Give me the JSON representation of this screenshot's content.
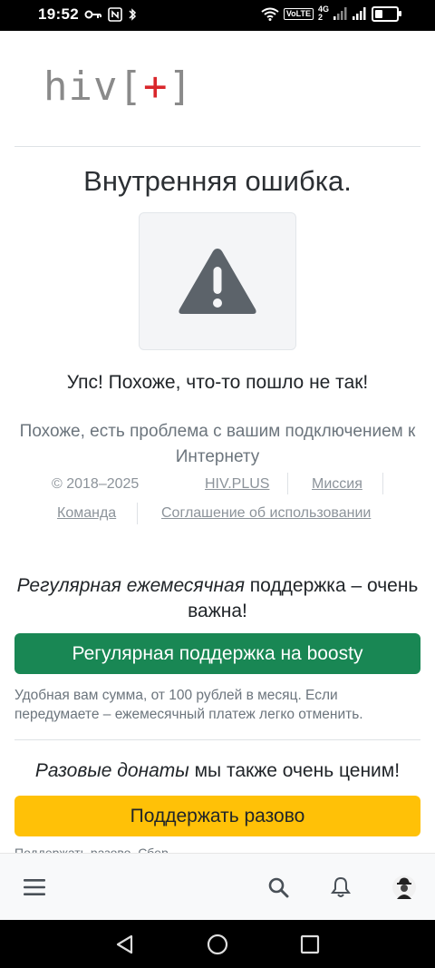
{
  "status_bar": {
    "time": "19:52",
    "volte": "VoLTE",
    "network": "4G",
    "sim_slot": "2",
    "battery_level": 0.35
  },
  "logo": {
    "left": "hiv[",
    "plus": "+",
    "right": "]"
  },
  "error": {
    "title": "Внутренняя ошибка.",
    "icon": "warning-triangle-icon",
    "oops": "Упс! Похоже, что-то пошло не так!",
    "connection_message": "Похоже, есть проблема с вашим подключением к Интернету"
  },
  "footer": {
    "copyright": "© 2018–2025",
    "links": [
      "HIV.PLUS",
      "Миссия",
      "Команда",
      "Соглашение об использовании"
    ]
  },
  "support": {
    "heading_italic": "Регулярная ежемесячная",
    "heading_rest": "поддержка – очень важна!",
    "boosty_button": "Регулярная поддержка на boosty",
    "note": "Удобная вам сумма, от 100 рублей в месяц. Если передумаете – ежемесячный платеж легко отменить.",
    "once_heading_italic": "Разовые донаты",
    "once_heading_rest": "мы также очень ценим!",
    "once_button": "Поддержать разово",
    "cut_text": "Поддержать разово, Сбер"
  },
  "colors": {
    "accent_green": "#198754",
    "accent_yellow": "#ffc107",
    "logo_plus": "#d9262b",
    "warning_icon": "#5c636a"
  },
  "bottom_bar": [
    "menu-icon",
    "search-icon",
    "bell-icon",
    "avatar"
  ],
  "system_nav": [
    "back-icon",
    "home-icon",
    "recents-icon"
  ]
}
